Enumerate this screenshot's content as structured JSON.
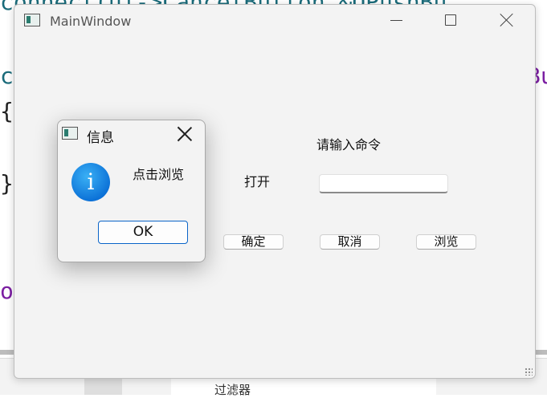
{
  "editor": {
    "line1": "connect(ui->CancelButton,&QPushBu",
    "line2": "c                                      Bu",
    "line3": "{",
    "line4": "}",
    "line5": "o",
    "toolbar_filter_label": "过滤器"
  },
  "main_window": {
    "title": "MainWindow",
    "command_label": "请输入命令",
    "open_label": "打开",
    "command_input_value": "",
    "ok_button": "确定",
    "cancel_button": "取消",
    "browse_button": "浏览"
  },
  "message_box": {
    "title": "信息",
    "icon_glyph": "i",
    "text": "点击浏览",
    "ok_button": "OK"
  },
  "colors": {
    "accent": "#0a64c8",
    "info_icon": "#0a6fd6",
    "code_teal": "#1a6b7a",
    "code_purple": "#7b1fa2"
  }
}
